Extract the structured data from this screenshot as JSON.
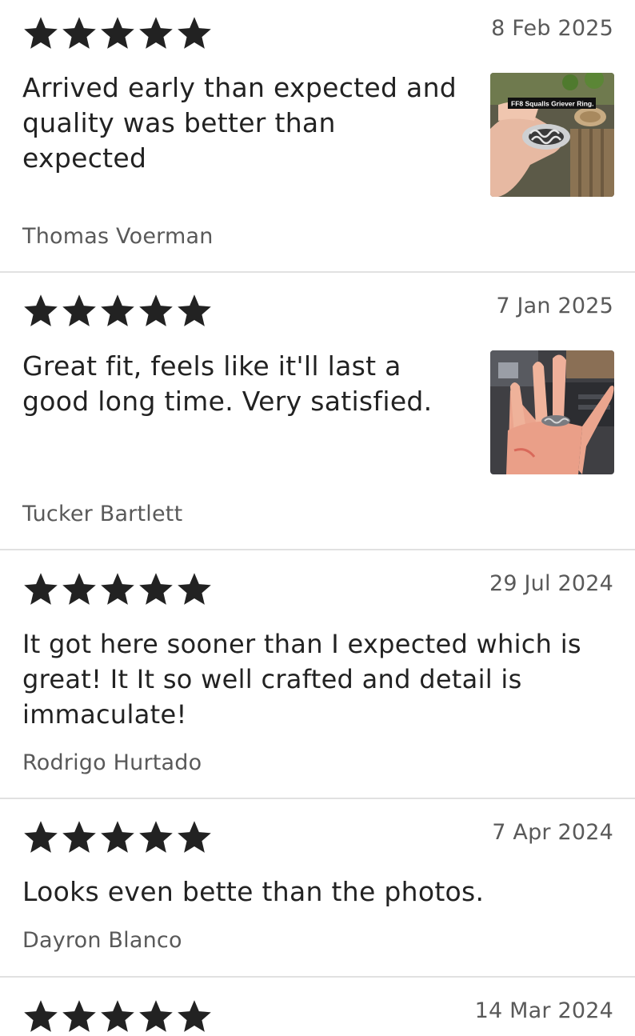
{
  "reviews": [
    {
      "rating": 5,
      "date": "8 Feb 2025",
      "text_lines": [
        "Arrived early than expected and",
        "quality was better than",
        "expected"
      ],
      "author": "Thomas Voerman",
      "photo_caption": "FF8 Squalls Griever Ring."
    },
    {
      "rating": 5,
      "date": "7 Jan 2025",
      "text_lines": [
        "Great fit, feels like it'll last a",
        "good long time. Very satisfied."
      ],
      "author": "Tucker Bartlett"
    },
    {
      "rating": 5,
      "date": "29 Jul 2024",
      "text_lines": [
        "It got here sooner than I expected which is",
        "great! It It so well crafted and detail is",
        "immaculate!"
      ],
      "author": "Rodrigo Hurtado"
    },
    {
      "rating": 5,
      "date": "7 Apr 2024",
      "text_lines": [
        "Looks even bette than the photos."
      ],
      "author": "Dayron Blanco"
    },
    {
      "rating": 5,
      "date": "14 Mar 2024"
    }
  ],
  "colors": {
    "star": "#222222",
    "divider": "#e1e1e1",
    "meta_text": "#595959",
    "body_text": "#222222"
  },
  "icons": {
    "star": "star-filled-icon"
  }
}
